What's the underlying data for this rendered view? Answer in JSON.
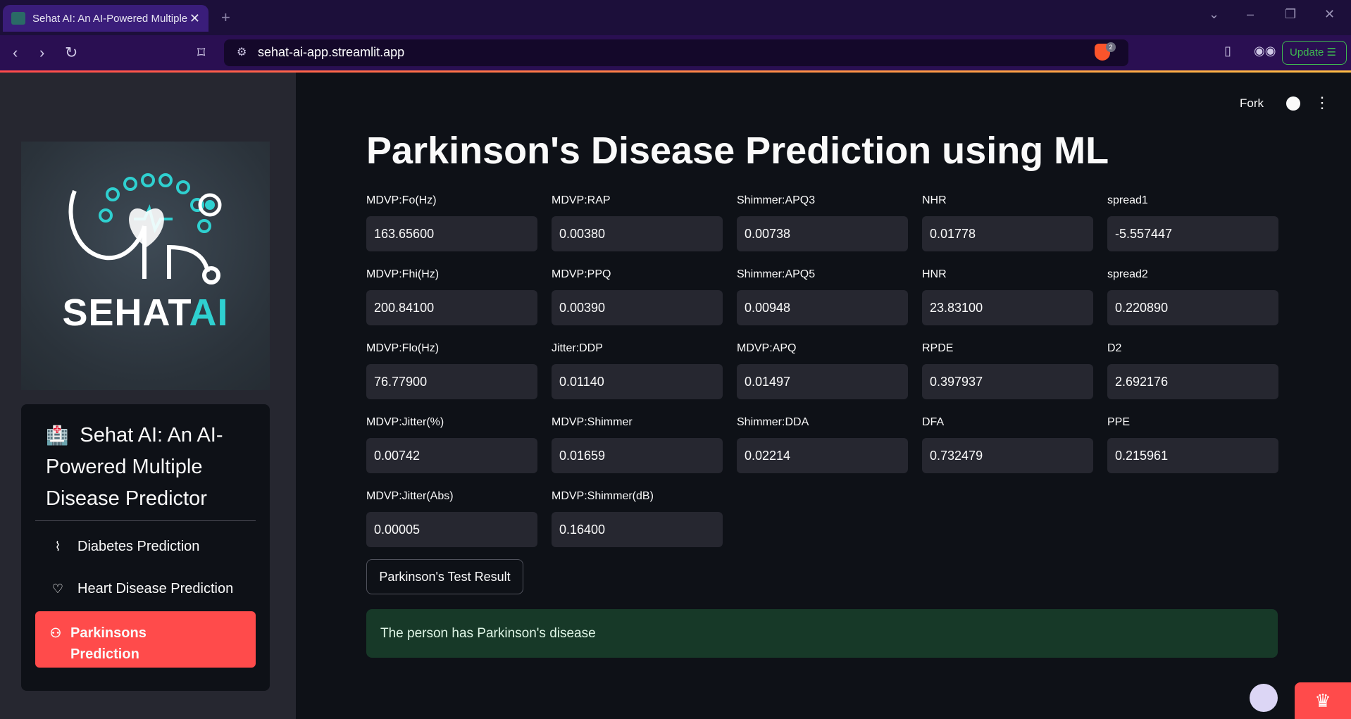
{
  "browser": {
    "tab_title": "Sehat AI: An AI-Powered Multiple Disease Predictor",
    "url": "sehat-ai-app.streamlit.app",
    "update_label": "Update",
    "brave_badge": "2"
  },
  "sidebar": {
    "logo_text_main": "SEHAT",
    "logo_text_accent": "AI",
    "title": "Sehat AI: An AI-Powered Multiple Disease Predictor",
    "items": [
      {
        "label": "Diabetes Prediction",
        "icon": "activity-icon"
      },
      {
        "label": "Heart Disease Prediction",
        "icon": "heart-icon"
      },
      {
        "label": "Parkinsons Prediction",
        "icon": "person-icon",
        "active": true
      }
    ]
  },
  "header": {
    "fork_label": "Fork"
  },
  "main": {
    "title": "Parkinson's Disease Prediction using ML",
    "fields": [
      {
        "label": "MDVP:Fo(Hz)",
        "value": "163.65600"
      },
      {
        "label": "MDVP:RAP",
        "value": "0.00380"
      },
      {
        "label": "Shimmer:APQ3",
        "value": "0.00738"
      },
      {
        "label": "NHR",
        "value": "0.01778"
      },
      {
        "label": "spread1",
        "value": "-5.557447"
      },
      {
        "label": "MDVP:Fhi(Hz)",
        "value": "200.84100"
      },
      {
        "label": "MDVP:PPQ",
        "value": "0.00390"
      },
      {
        "label": "Shimmer:APQ5",
        "value": "0.00948"
      },
      {
        "label": "HNR",
        "value": "23.83100"
      },
      {
        "label": "spread2",
        "value": "0.220890"
      },
      {
        "label": "MDVP:Flo(Hz)",
        "value": "76.77900"
      },
      {
        "label": "Jitter:DDP",
        "value": "0.01140"
      },
      {
        "label": "MDVP:APQ",
        "value": "0.01497"
      },
      {
        "label": "RPDE",
        "value": "0.397937"
      },
      {
        "label": "D2",
        "value": "2.692176"
      },
      {
        "label": "MDVP:Jitter(%)",
        "value": "0.00742"
      },
      {
        "label": "MDVP:Shimmer",
        "value": "0.01659"
      },
      {
        "label": "Shimmer:DDA",
        "value": "0.02214"
      },
      {
        "label": "DFA",
        "value": "0.732479"
      },
      {
        "label": "PPE",
        "value": "0.215961"
      },
      {
        "label": "MDVP:Jitter(Abs)",
        "value": "0.00005"
      },
      {
        "label": "MDVP:Shimmer(dB)",
        "value": "0.16400"
      }
    ],
    "result_button": "Parkinson's Test Result",
    "result_message": "The person has Parkinson's disease"
  },
  "colors": {
    "accent": "#ff4b4b",
    "success_bg": "#173928"
  }
}
